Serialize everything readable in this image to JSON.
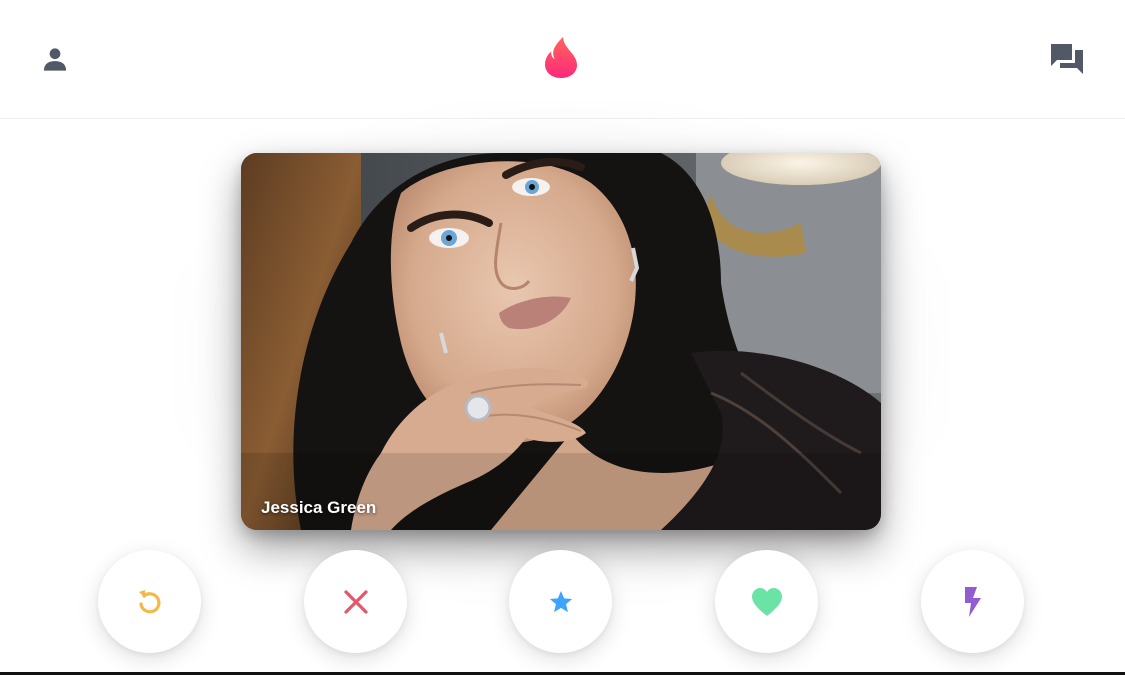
{
  "header": {
    "profile_icon": "person-icon",
    "logo_icon": "flame-logo",
    "messages_icon": "chat-bubbles-icon"
  },
  "card": {
    "name": "Jessica Green"
  },
  "actions": [
    {
      "icon": "rewind-icon",
      "color": "#F5B748"
    },
    {
      "icon": "close-icon",
      "color": "#E5566A"
    },
    {
      "icon": "star-icon",
      "color": "#3CA4FF"
    },
    {
      "icon": "heart-icon",
      "color": "#6BE3A5"
    },
    {
      "icon": "lightning-icon",
      "color": "#915DD1"
    }
  ],
  "colors": {
    "brand_gradient_start": "#FD297B",
    "brand_gradient_end": "#FF655B",
    "header_icon": "#505965"
  }
}
